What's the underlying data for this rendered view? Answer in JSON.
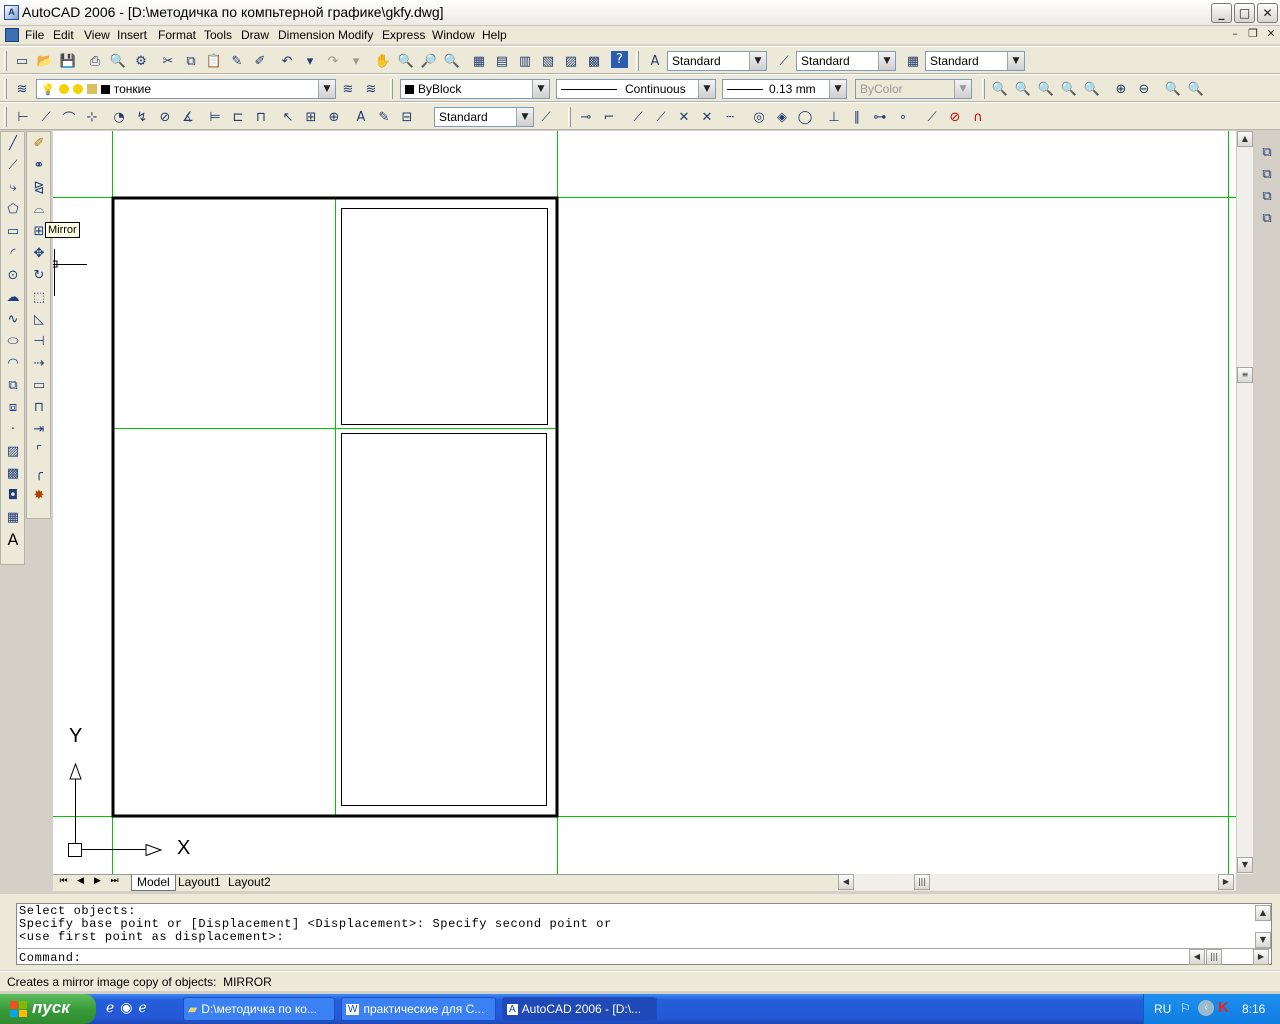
{
  "window": {
    "title": "AutoCAD 2006 - [D:\\методичка по компьтерной графике\\gkfy.dwg]",
    "app_icon_text": "A"
  },
  "menu": [
    "File",
    "Edit",
    "View",
    "Insert",
    "Format",
    "Tools",
    "Draw",
    "Dimension",
    "Modify",
    "Express",
    "Window",
    "Help"
  ],
  "styles_toolbar": {
    "text_style": "Standard",
    "dim_style": "Standard",
    "table_style": "Standard"
  },
  "layers_toolbar": {
    "layer": "тонкие",
    "color": "ByBlock",
    "linetype": "Continuous",
    "lineweight": "0.13 mm",
    "plotstyle": "ByColor"
  },
  "dimension_toolbar": {
    "dim_style": "Standard"
  },
  "tooltip": {
    "text": "Mirror"
  },
  "ucs": {
    "x_label": "X",
    "y_label": "Y"
  },
  "tabs": [
    "Model",
    "Layout1",
    "Layout2"
  ],
  "command_window": {
    "lines": [
      "Select objects:",
      "Specify base point or [Displacement] <Displacement>: Specify second point or",
      "<use first point as displacement>:"
    ],
    "prompt": "Command:"
  },
  "status_text": "Creates a mirror image copy of objects:  MIRROR",
  "taskbar": {
    "start": "пуск",
    "items": [
      "D:\\методичка по ко...",
      "практические для С...",
      "AutoCAD 2006 - [D:\\..."
    ],
    "lang": "RU",
    "clock": "8:16"
  },
  "colors": {
    "construction_lines": "#00c800",
    "titlebar": "#eceae4",
    "toolbar_bg": "#ece9d8",
    "taskbar": "#245edb"
  }
}
